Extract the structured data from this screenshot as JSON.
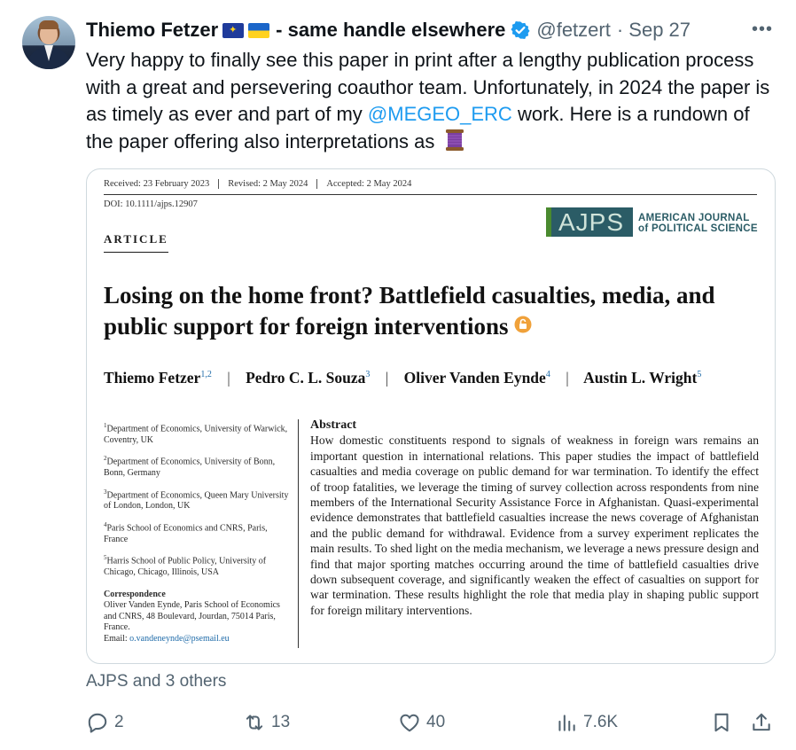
{
  "author": {
    "name": "Thiemo Fetzer",
    "name_suffix": "- same handle elsewhere",
    "handle": "@fetzert",
    "date": "· Sep 27"
  },
  "tweet": {
    "text_before_mention": "Very happy to finally see this paper in print after a lengthy publication process with a great and persevering coauthor team. Unfortunately, in 2024 the paper is as timely as ever and part of my ",
    "mention": "@MEGEO_ERC",
    "text_after_mention": " work. Here is a rundown of the paper offering also  interpretations as "
  },
  "paper": {
    "received": "Received: 23 February 2023",
    "revised": "Revised: 2 May 2024",
    "accepted": "Accepted: 2 May 2024",
    "doi": "DOI: 10.1111/ajps.12907",
    "section": "ARTICLE",
    "journal_logo": "AJPS",
    "journal_name_line1": "AMERICAN JOURNAL",
    "journal_name_line2": "of POLITICAL SCIENCE",
    "title": "Losing on the home front? Battlefield casualties, media, and public support for foreign interventions",
    "authors": [
      {
        "name": "Thiemo Fetzer",
        "sup": "1,2"
      },
      {
        "name": "Pedro C. L. Souza",
        "sup": "3"
      },
      {
        "name": "Oliver Vanden Eynde",
        "sup": "4"
      },
      {
        "name": "Austin L. Wright",
        "sup": "5"
      }
    ],
    "author_separator": "|",
    "affiliations": [
      {
        "sup": "1",
        "text": "Department of Economics, University of Warwick, Coventry, UK"
      },
      {
        "sup": "2",
        "text": "Department of Economics, University of Bonn, Bonn, Germany"
      },
      {
        "sup": "3",
        "text": "Department of Economics, Queen Mary University of London, London, UK"
      },
      {
        "sup": "4",
        "text": "Paris School of Economics and CNRS, Paris, France"
      },
      {
        "sup": "5",
        "text": "Harris School of Public Policy, University of Chicago, Chicago, Illinois, USA"
      }
    ],
    "correspondence_heading": "Correspondence",
    "correspondence_text": "Oliver Vanden Eynde, Paris School of Economics and CNRS, 48 Boulevard, Jourdan, 75014 Paris, France.",
    "email_label": "Email: ",
    "email": "o.vandeneynde@psemail.eu",
    "abstract_heading": "Abstract",
    "abstract": "How domestic constituents respond to signals of weakness in foreign wars remains an important question in international relations. This paper studies the impact of battlefield casualties and media coverage on public demand for war termination. To identify the effect of troop fatalities, we leverage the timing of survey collection across respondents from nine members of the International Security Assistance Force in Afghanistan. Quasi-experimental evidence demonstrates that battlefield casualties increase the news coverage of Afghanistan and the public demand for withdrawal. Evidence from a survey experiment replicates the main results. To shed light on the media mechanism, we leverage a news pressure design and find that major sporting matches occurring around the time of battlefield casualties drive down subsequent coverage, and significantly weaken the effect of casualties on support for war termination. These results highlight the role that media play in shaping public support for foreign military interventions."
  },
  "engagement": "AJPS and 3 others",
  "actions": {
    "replies": "2",
    "reposts": "13",
    "likes": "40",
    "views": "7.6K"
  },
  "colors": {
    "accent": "#1d9bf0",
    "muted": "#536471",
    "text": "#0f1419",
    "border": "#cfd9de"
  }
}
